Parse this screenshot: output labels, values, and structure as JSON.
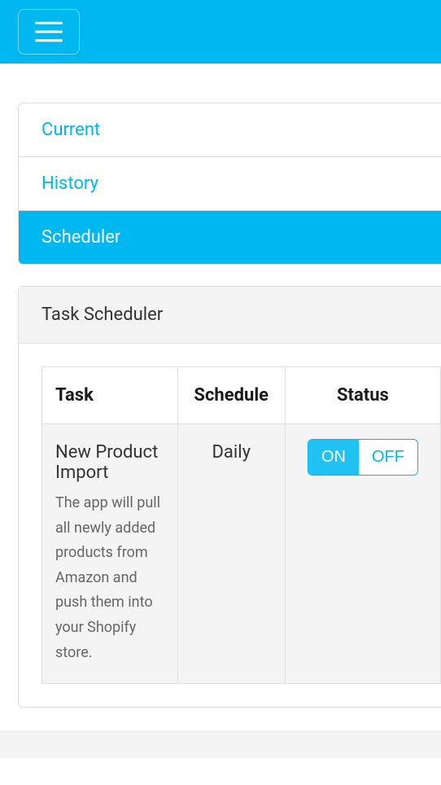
{
  "nav": {
    "items": [
      {
        "label": "Current",
        "active": false
      },
      {
        "label": "History",
        "active": false
      },
      {
        "label": "Scheduler",
        "active": true
      }
    ]
  },
  "panel": {
    "title": "Task Scheduler",
    "columns": {
      "task": "Task",
      "schedule": "Schedule",
      "status": "Status"
    },
    "rows": [
      {
        "task_name": "New Product Import",
        "task_desc": "The app will pull all newly added products from Amazon and push them into your Shopify store.",
        "schedule": "Daily",
        "status_on": "ON",
        "status_off": "OFF",
        "status_value": "ON"
      }
    ]
  }
}
